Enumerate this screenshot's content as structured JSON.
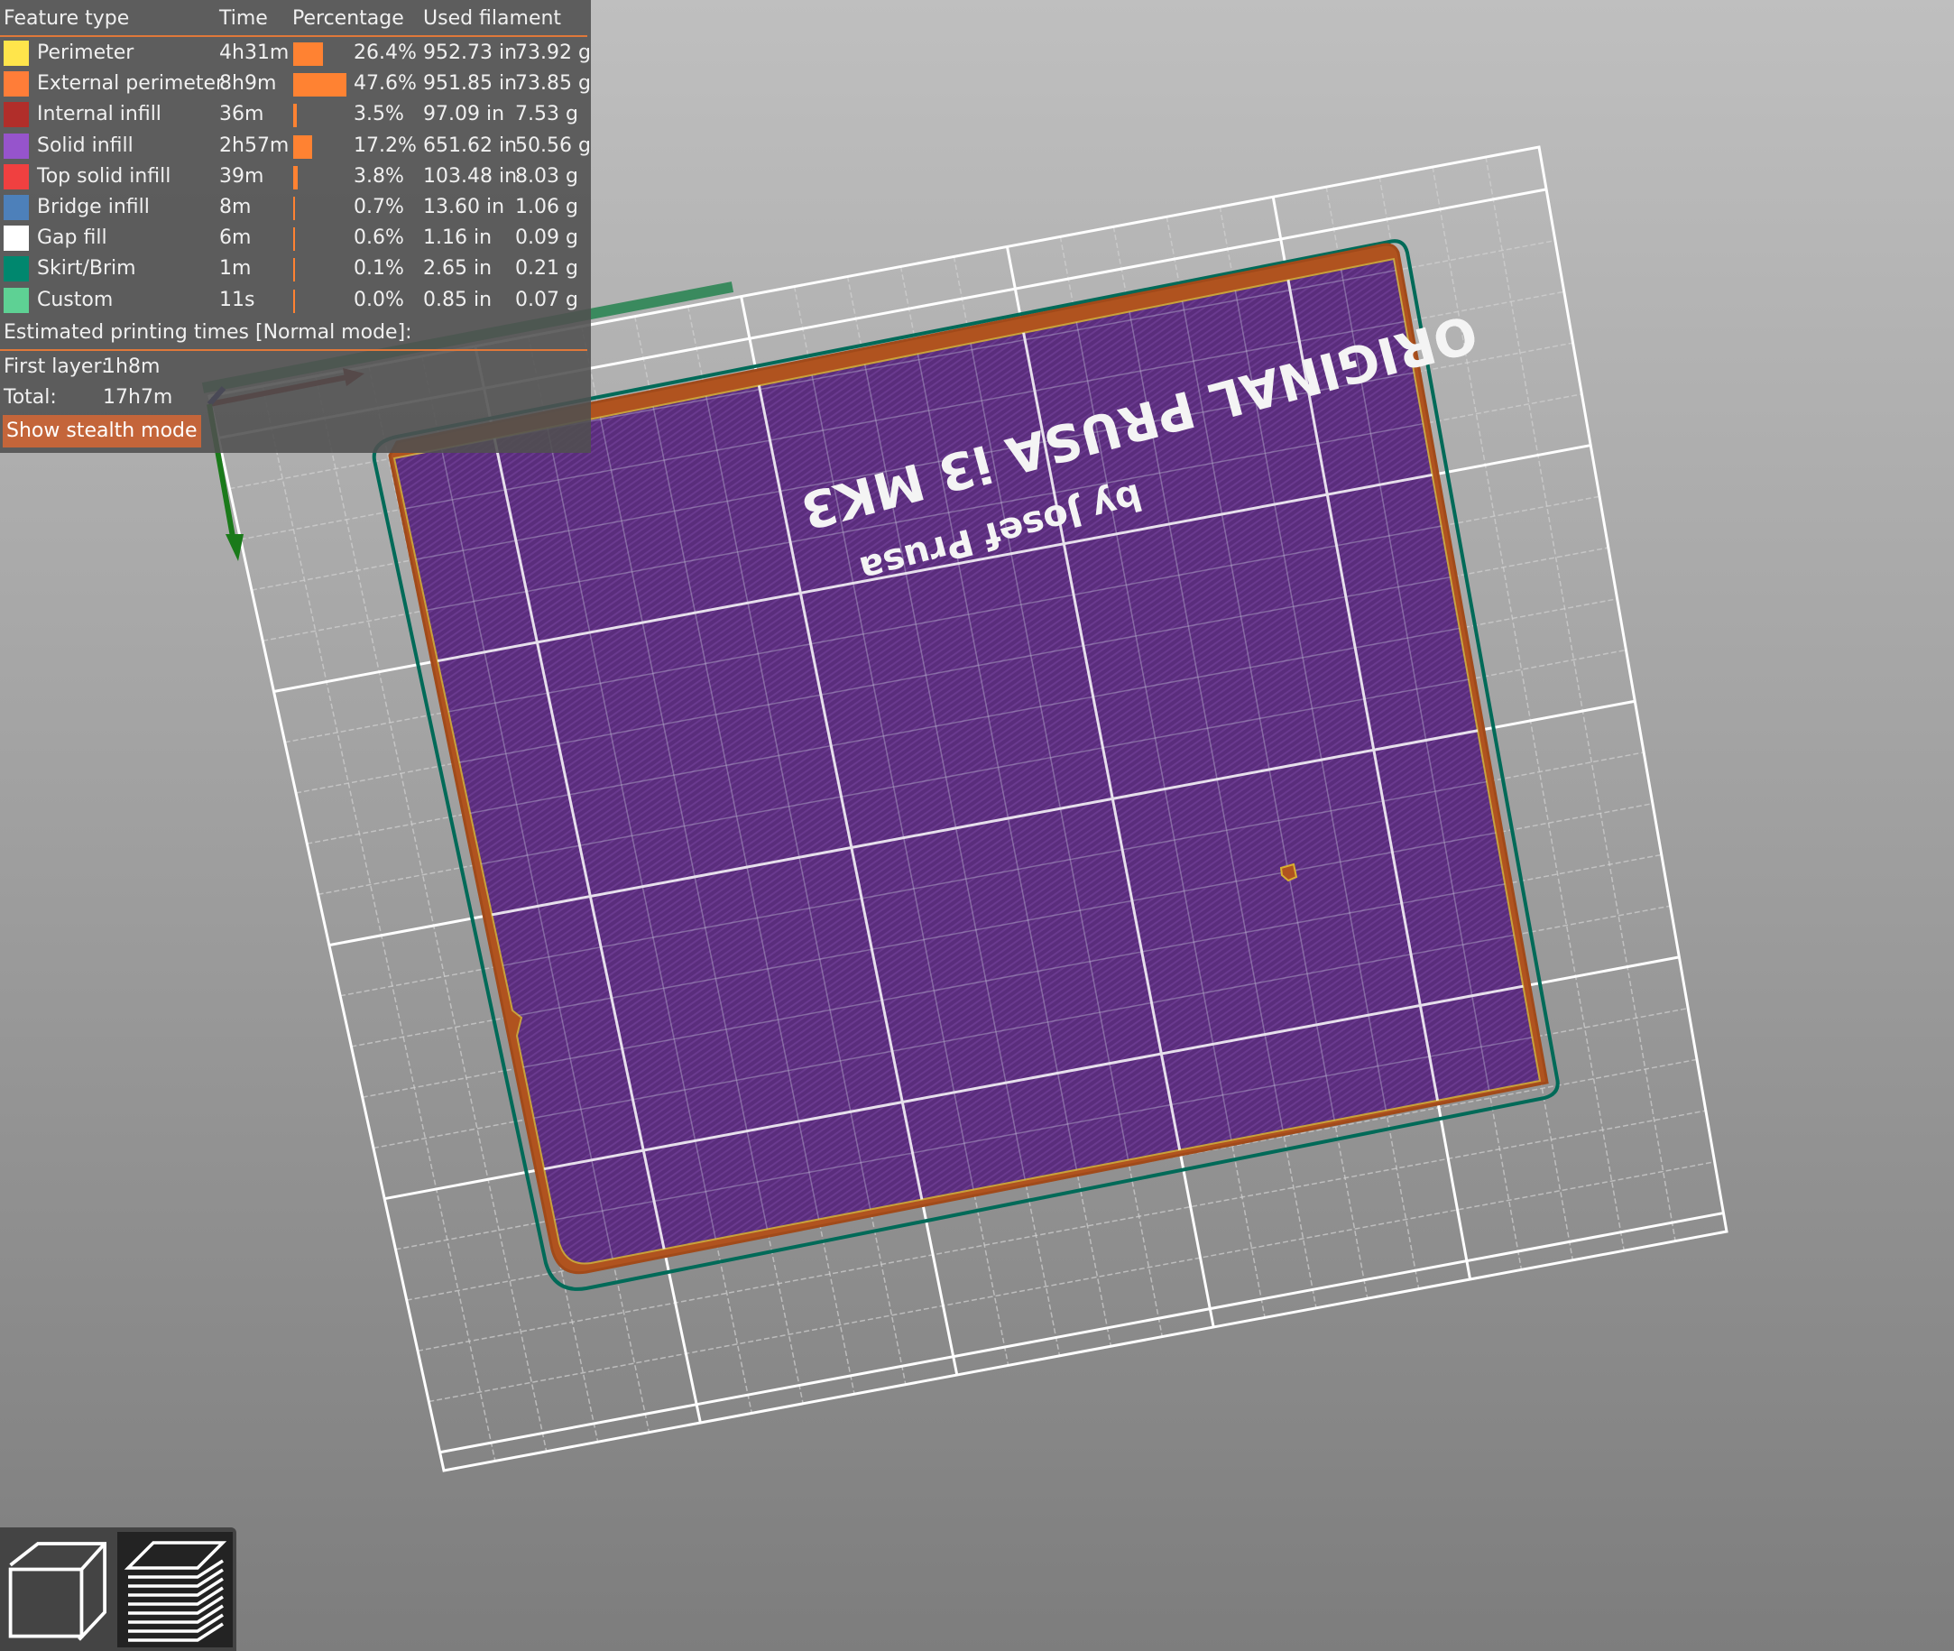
{
  "legend": {
    "headers": {
      "feature_type": "Feature type",
      "time": "Time",
      "percentage": "Percentage",
      "used_filament": "Used filament"
    },
    "rows": [
      {
        "name": "Perimeter",
        "color": "#ffe54b",
        "time": "4h31m",
        "percent": "26.4%",
        "percent_value": 26.4,
        "length": "952.73 in",
        "weight": "73.92 g"
      },
      {
        "name": "External perimeter",
        "color": "#ff7d38",
        "time": "8h9m",
        "percent": "47.6%",
        "percent_value": 47.6,
        "length": "951.85 in",
        "weight": "73.85 g"
      },
      {
        "name": "Internal infill",
        "color": "#b12e2a",
        "time": "36m",
        "percent": "3.5%",
        "percent_value": 3.5,
        "length": "97.09 in",
        "weight": "7.53 g"
      },
      {
        "name": "Solid infill",
        "color": "#9654cc",
        "time": "2h57m",
        "percent": "17.2%",
        "percent_value": 17.2,
        "length": "651.62 in",
        "weight": "50.56 g"
      },
      {
        "name": "Top solid infill",
        "color": "#f04040",
        "time": "39m",
        "percent": "3.8%",
        "percent_value": 3.8,
        "length": "103.48 in",
        "weight": "8.03 g"
      },
      {
        "name": "Bridge infill",
        "color": "#4d80ba",
        "time": "8m",
        "percent": "0.7%",
        "percent_value": 0.7,
        "length": "13.60 in",
        "weight": "1.06 g"
      },
      {
        "name": "Gap fill",
        "color": "#ffffff",
        "time": "6m",
        "percent": "0.6%",
        "percent_value": 0.6,
        "length": "1.16 in",
        "weight": "0.09 g"
      },
      {
        "name": "Skirt/Brim",
        "color": "#00876e",
        "time": "1m",
        "percent": "0.1%",
        "percent_value": 0.1,
        "length": "2.65 in",
        "weight": "0.21 g"
      },
      {
        "name": "Custom",
        "color": "#5ed194",
        "time": "11s",
        "percent": "0.0%",
        "percent_value": 0.0,
        "length": "0.85 in",
        "weight": "0.07 g"
      }
    ],
    "estimated_title": "Estimated printing times [Normal mode]:",
    "first_layer_label": "First layer:",
    "first_layer_value": "1h8m",
    "total_label": "Total:",
    "total_value": "17h7m",
    "stealth_button": "Show stealth mode",
    "bar_color": "#ff8232",
    "separator_color": "#e0783a"
  },
  "bed": {
    "text_line1": "ORIGINAL PRUSA i3 MK3",
    "text_line2": "by Josef Prusa",
    "object_color": "#5a2d7c",
    "perimeter_color": "#b0531f",
    "skirt_color": "#006a58"
  },
  "view_toggle": {
    "buttons": [
      {
        "name": "3d-view",
        "icon": "cube-icon",
        "selected": false
      },
      {
        "name": "preview",
        "icon": "layers-icon",
        "selected": true
      }
    ]
  }
}
